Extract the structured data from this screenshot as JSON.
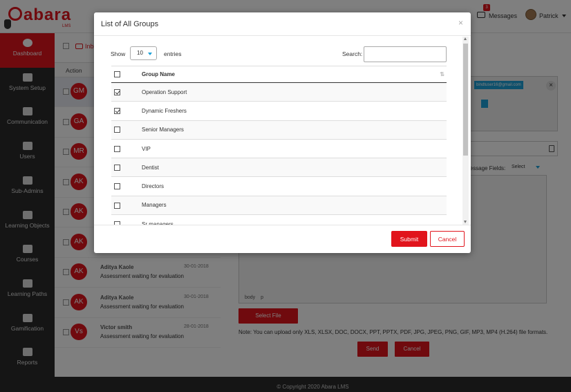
{
  "app": {
    "logo_text": "abara",
    "logo_sub": "LMS"
  },
  "header": {
    "messages_label": "Messages",
    "messages_count": "3",
    "user_name": "Patrick"
  },
  "sidebar": {
    "items": [
      {
        "label": "Dashboard",
        "icon": "dashboard-icon",
        "active": true
      },
      {
        "label": "System Setup",
        "icon": "gear-icon"
      },
      {
        "label": "Communication",
        "icon": "inbox-icon"
      },
      {
        "label": "Users",
        "icon": "users-icon"
      },
      {
        "label": "Sub-Admins",
        "icon": "org-chart-icon"
      },
      {
        "label": "Learning Objects",
        "icon": "server-icon"
      },
      {
        "label": "Courses",
        "icon": "monitor-icon"
      },
      {
        "label": "Learning Paths",
        "icon": "road-icon"
      },
      {
        "label": "Gamification",
        "icon": "trophy-icon"
      },
      {
        "label": "Reports",
        "icon": "report-icon"
      }
    ]
  },
  "inbox": {
    "label": "Inbox",
    "header_action": "Action",
    "messages": [
      {
        "initials": "GM"
      },
      {
        "initials": "GA"
      },
      {
        "initials": "MR"
      },
      {
        "initials": "AK"
      },
      {
        "initials": "AK"
      },
      {
        "initials": "AK"
      },
      {
        "initials": "AK",
        "from": "Aditya Kaole",
        "date": "30-01-2018",
        "subject": "Assessment waiting for evaluation"
      },
      {
        "initials": "AK",
        "from": "Aditya Kaole",
        "date": "30-01-2018",
        "subject": "Assessment waiting for evaluation"
      },
      {
        "initials": "Vs",
        "from": "Victor smith",
        "date": "28-01-2018",
        "subject": "Assessment waiting for evaluation"
      }
    ]
  },
  "compose": {
    "to_tags": [
      "bindtuser16@gmail.com",
      ""
    ],
    "message_fields_label": "Message Fields:",
    "message_fields_select": "Select",
    "editor_status": [
      "body",
      "p"
    ],
    "select_file": "Select File",
    "note": "Note: You can upload only XLS, XLSX, DOC, DOCX, PPT, PPTX, PDF, JPG, JPEG, PNG, GIF, MP3, MP4 (H.264) file formats.",
    "send": "Send",
    "cancel": "Cancel"
  },
  "footer": {
    "text": "© Copyright 2020 Abara LMS"
  },
  "modal": {
    "title": "List of All Groups",
    "close": "×",
    "show_label": "Show",
    "page_length": "10",
    "entries_label": "entries",
    "search_label": "Search:",
    "search_value": "",
    "column_header": "Group Name",
    "groups": [
      {
        "name": "Operation Support",
        "checked": true
      },
      {
        "name": "Dynamic Freshers",
        "checked": true
      },
      {
        "name": "Senior Managers",
        "checked": false
      },
      {
        "name": "VIP",
        "checked": false
      },
      {
        "name": "Dentist",
        "checked": false
      },
      {
        "name": "Directors",
        "checked": false
      },
      {
        "name": "Managers",
        "checked": false
      },
      {
        "name": "Sr managers",
        "checked": false
      }
    ],
    "submit": "Submit",
    "cancel": "Cancel"
  },
  "colors": {
    "brand_red": "#e1141c",
    "sidebar_dark": "#2b2b2b",
    "accent_blue": "#1da1d8"
  }
}
